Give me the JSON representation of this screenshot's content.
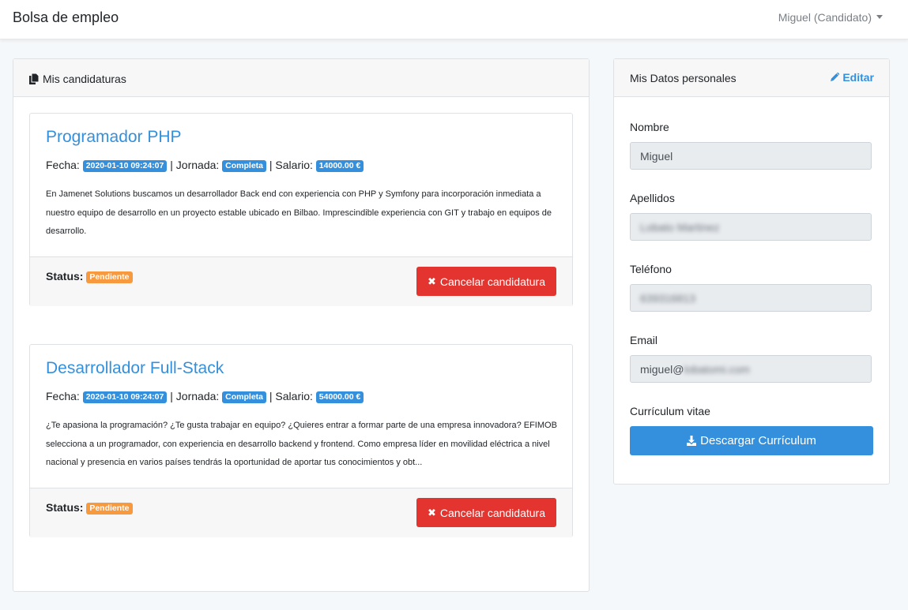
{
  "navbar": {
    "brand": "Bolsa de empleo",
    "user_menu": "Miguel (Candidato)"
  },
  "applications": {
    "header": "Mis candidaturas",
    "jobs": [
      {
        "title": "Programador PHP",
        "fecha_label": "Fecha:",
        "fecha": "2020-01-10 09:24:07",
        "jornada_label": "| Jornada:",
        "jornada": "Completa",
        "salario_label": "| Salario:",
        "salario": "14000.00 €",
        "description": "En Jamenet Solutions buscamos un desarrollador Back end con experiencia con PHP y Symfony para incorporación inmediata a nuestro equipo de desarrollo en un proyecto estable ubicado en Bilbao. Imprescindible experiencia con GIT y trabajo en equipos de desarrollo.",
        "status_label": "Status:",
        "status": "Pendiente",
        "cancel_label": "Cancelar candidatura"
      },
      {
        "title": "Desarrollador Full-Stack",
        "fecha_label": "Fecha:",
        "fecha": "2020-01-10 09:24:07",
        "jornada_label": "| Jornada:",
        "jornada": "Completa",
        "salario_label": "| Salario:",
        "salario": "54000.00 €",
        "description": "¿Te apasiona la programación? ¿Te gusta trabajar en equipo? ¿Quieres entrar a formar parte de una empresa innovadora? EFIMOB selecciona a un programador, con experiencia en desarrollo backend y frontend. Como empresa líder en movilidad eléctrica a nivel nacional y presencia en varios países tendrás la oportunidad de aportar tus conocimientos y obt...",
        "status_label": "Status:",
        "status": "Pendiente",
        "cancel_label": "Cancelar candidatura"
      }
    ]
  },
  "personal": {
    "header": "Mis Datos personales",
    "edit_label": "Editar",
    "nombre_label": "Nombre",
    "nombre_value": "Miguel",
    "apellidos_label": "Apellidos",
    "apellidos_value": "Lobato Martinez",
    "telefono_label": "Teléfono",
    "telefono_value": "639316813",
    "email_label": "Email",
    "email_value_prefix": "miguel@",
    "email_value_hidden": "lobatomi.com",
    "cv_label": "Currículum vitae",
    "download_label": "Descargar Currículum"
  },
  "colors": {
    "primary": "#3490dc",
    "danger": "#e3342f",
    "warning": "#f6993f"
  }
}
